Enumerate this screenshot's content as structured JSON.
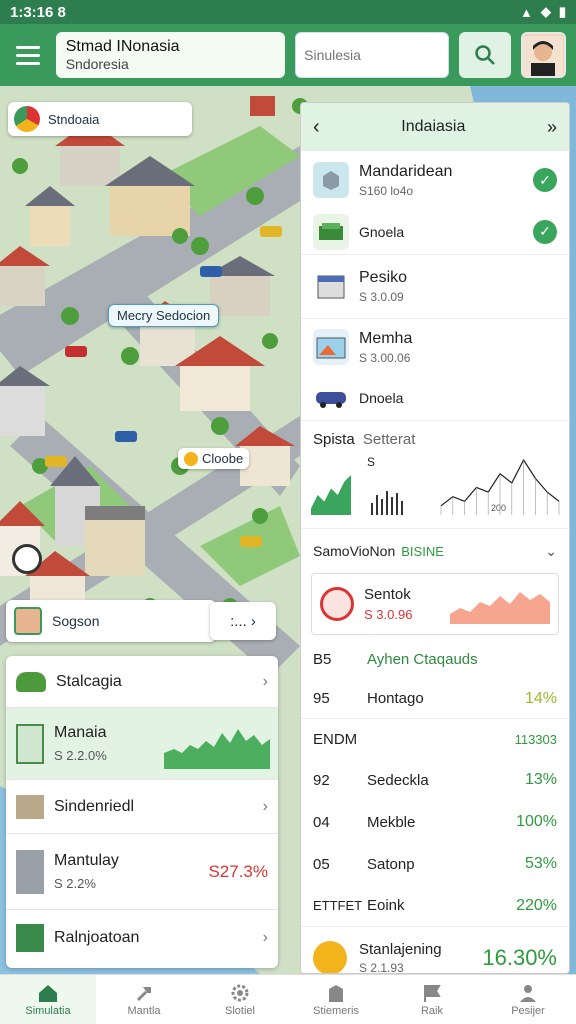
{
  "status": {
    "time": "1:3:16 8"
  },
  "header": {
    "title": "Stmad INonasia",
    "subtitle": "Sndoresia",
    "search_placeholder": "Sinulesia"
  },
  "map": {
    "location_label": "Stndoaia",
    "area_label": "Mecry Sedocion",
    "marker_label": "Cloobe",
    "player_label": "Sogson",
    "more_label": ":...  ›"
  },
  "right_panel": {
    "title": "Indaiasia",
    "items": [
      {
        "name": "Mandaridean",
        "sub": "S160 lo4o"
      },
      {
        "name": "Gnoela",
        "sub": ""
      },
      {
        "name": "Pesiko",
        "sub": "S 3.0.09"
      },
      {
        "name": "Memha",
        "sub": "S 3.00.06"
      },
      {
        "name": "Dnoela",
        "sub": ""
      }
    ],
    "chart_title": "Spista",
    "chart_subtitle": "Setterat",
    "chart_value": "S",
    "chart_axis": "200",
    "section_title": "SamoVioNon",
    "section_badge": "BISINE",
    "featured": {
      "name": "Sentok",
      "value": "S 3.0.96"
    },
    "rows": [
      {
        "c1": "B5",
        "c2": "Ayhen Ctaqauds",
        "c3": ""
      },
      {
        "c1": "95",
        "c2": "Hontago",
        "c3": "14%"
      },
      {
        "c1": "ENDM",
        "c2": "",
        "c3": "113303"
      },
      {
        "c1": "92",
        "c2": "Sedeckla",
        "c3": "13%"
      },
      {
        "c1": "04",
        "c2": "Mekble",
        "c3": "100%"
      },
      {
        "c1": "05",
        "c2": "Satonp",
        "c3": "53%"
      },
      {
        "c1": "ETTFET",
        "c2": "Eoink",
        "c3": "220%"
      }
    ],
    "footer": {
      "name": "Stanlajening",
      "sub": "S 2.1.93",
      "value": "16.30%"
    }
  },
  "left_panel": {
    "items": [
      {
        "label": "Stalcagia",
        "sub": ""
      },
      {
        "label": "Manaia",
        "sub": "S 2.2.0%"
      },
      {
        "label": "Sindenriedl",
        "sub": ""
      },
      {
        "label": "Mantulay",
        "sub": "S 2.2%",
        "value": "S27.3%"
      },
      {
        "label": "Ralnjoatoan",
        "sub": ""
      }
    ]
  },
  "bottom_nav": [
    {
      "label": "Simulatia",
      "icon": "home-icon"
    },
    {
      "label": "Mantla",
      "icon": "hammer-icon"
    },
    {
      "label": "Slotiel",
      "icon": "gear-icon"
    },
    {
      "label": "Stiemeris",
      "icon": "building-icon"
    },
    {
      "label": "Raik",
      "icon": "flag-icon"
    },
    {
      "label": "Pesijer",
      "icon": "person-icon"
    }
  ],
  "colors": {
    "primary": "#3a9a5c",
    "accent_green": "#2e9a3e",
    "accent_red": "#d33333"
  },
  "chart_data": [
    {
      "type": "area",
      "values": [
        1,
        3,
        2,
        4,
        3,
        5,
        6
      ],
      "title": ""
    },
    {
      "type": "line",
      "values": [
        2,
        4,
        3,
        6,
        5,
        9,
        7,
        12,
        8,
        5,
        3
      ],
      "title": ""
    }
  ]
}
